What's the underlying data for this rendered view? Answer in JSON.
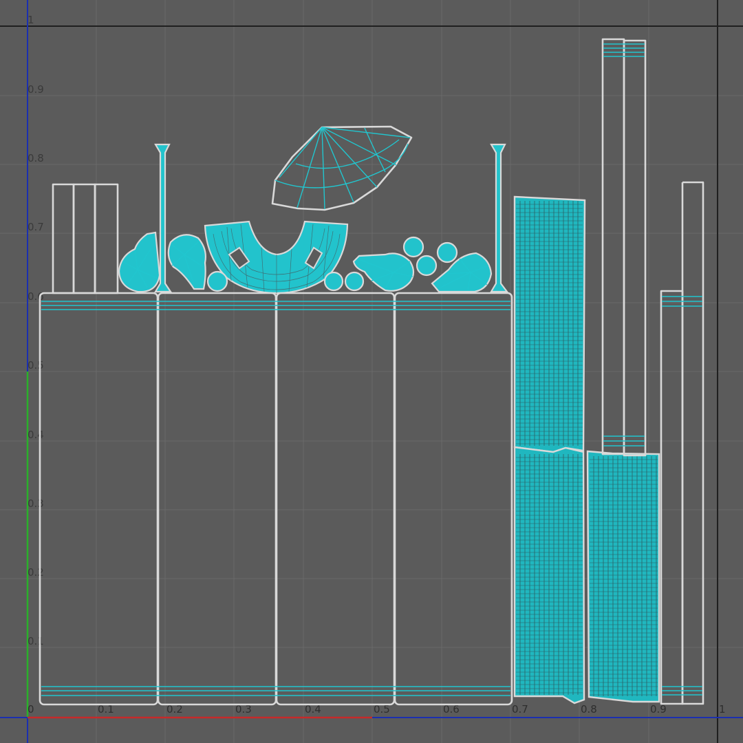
{
  "uv_editor": {
    "u_axis": {
      "ticks": [
        "0",
        "0.1",
        "0.2",
        "0.3",
        "0.4",
        "0.5",
        "0.6",
        "0.7",
        "0.8",
        "0.9",
        "1"
      ]
    },
    "v_axis": {
      "ticks": [
        "0.1",
        "0.2",
        "0.3",
        "0.4",
        "0.5",
        "0.6",
        "0.7",
        "0.8",
        "0.9",
        "1"
      ]
    },
    "colors": {
      "background": "#5b5b5b",
      "grid": "#6a6a6a",
      "uv_border": "#1f1f1f",
      "u_axis": "#c62a2a",
      "v_axis": "#2bb02b",
      "axis_extension": "#1b2fb0",
      "shell_outline": "#d9d9d9",
      "uv_wireframe": "#21c6cf"
    }
  }
}
